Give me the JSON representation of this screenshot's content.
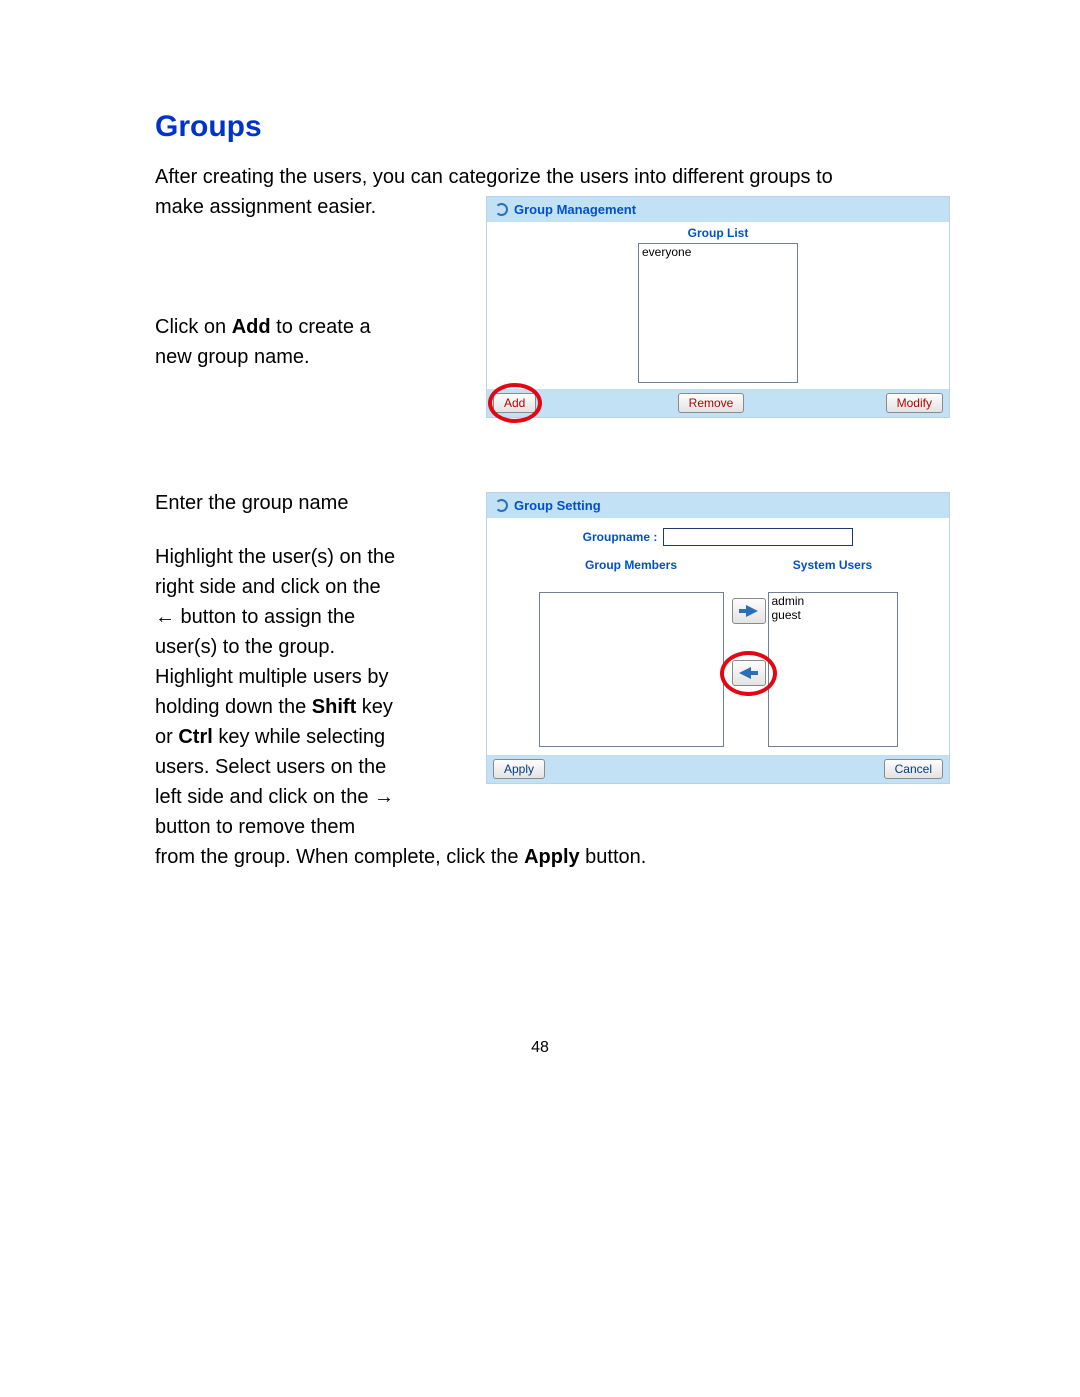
{
  "heading": "Groups",
  "intro_line1": "After creating the users, you can categorize the users into different groups to",
  "intro_line2": "make assignment easier.",
  "instr_add_1": "Click on ",
  "instr_add_bold": "Add",
  "instr_add_2": " to create a",
  "instr_add_3": "new group name.",
  "gm": {
    "title": "Group Management",
    "grouplist_label": "Group List",
    "items": [
      "everyone"
    ],
    "buttons": {
      "add": "Add",
      "remove": "Remove",
      "modify": "Modify"
    }
  },
  "instr_enter": "Enter the group name",
  "instr_block_lines": [
    "Highlight the user(s) on the",
    "right side and click on the",
    "← button to assign the",
    "user(s) to the group.",
    "Highlight multiple users by"
  ],
  "instr_shift_pre": "holding down the ",
  "instr_shift_bold": "Shift",
  "instr_shift_post": " key",
  "instr_ctrl_pre": "or ",
  "instr_ctrl_bold": "Ctrl",
  "instr_ctrl_post": " key while selecting",
  "instr_block2_lines": [
    "users. Select users on the",
    "left side and click on the →",
    "button to remove them"
  ],
  "instr_apply_pre": "from the group. When complete, click the ",
  "instr_apply_bold": "Apply",
  "instr_apply_post": " button.",
  "gs": {
    "title": "Group Setting",
    "groupname_label": "Groupname :",
    "groupname_value": "",
    "members_label": "Group Members",
    "users_label": "System Users",
    "users": [
      "admin",
      "guest"
    ],
    "buttons": {
      "apply": "Apply",
      "cancel": "Cancel"
    }
  },
  "page_number": "48"
}
